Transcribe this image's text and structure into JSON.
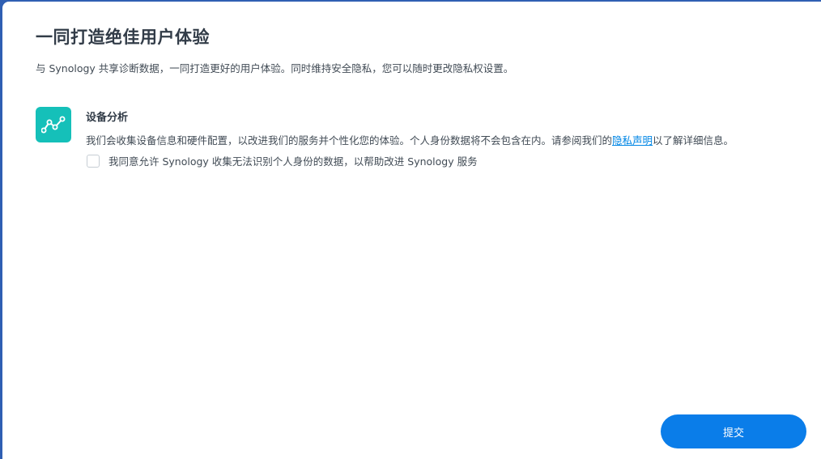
{
  "header": {
    "title": "一同打造绝佳用户体验",
    "subtitle": "与 Synology 共享诊断数据，一同打造更好的用户体验。同时维持安全隐私，您可以随时更改隐私权设置。"
  },
  "device_analytics": {
    "icon": "analytics-line-chart-icon",
    "title": "设备分析",
    "description_before_link": "我们会收集设备信息和硬件配置，以改进我们的服务并个性化您的体验。个人身份数据将不会包含在内。请参阅我们的",
    "link_text": "隐私声明",
    "description_after_link": "以了解详细信息。",
    "consent_label": "我同意允许 Synology 收集无法识别个人身份的数据，以帮助改进 Synology 服务",
    "consent_checked": false
  },
  "footer": {
    "submit_label": "提交"
  },
  "colors": {
    "accent": "#0a7de9",
    "icon_bg": "#15c0b9",
    "link": "#0086e5",
    "title_text": "#323c48"
  }
}
